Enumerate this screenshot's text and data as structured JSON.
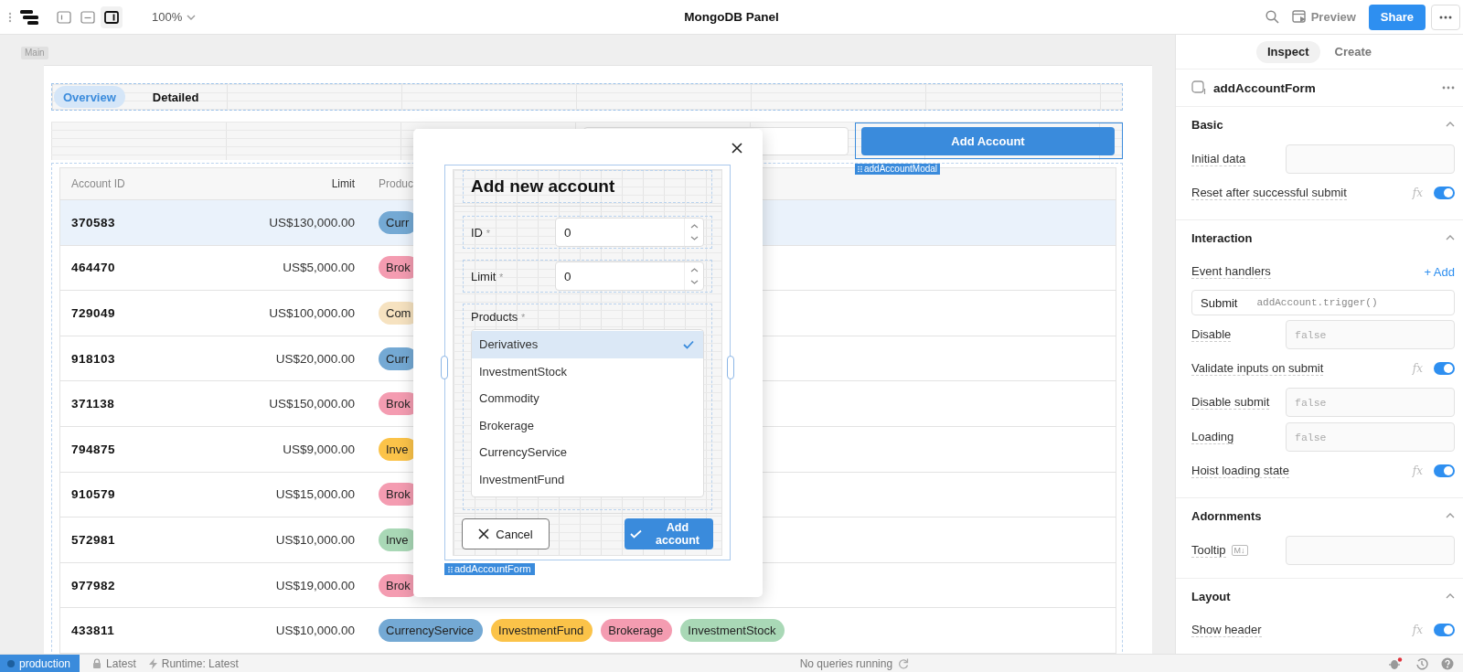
{
  "toolbar": {
    "layout_buttons": [
      {
        "kind": "left",
        "selected": false
      },
      {
        "kind": "bottom",
        "selected": false
      },
      {
        "kind": "right",
        "selected": true
      }
    ],
    "zoom": "100%",
    "title": "MongoDB Panel",
    "preview": "Preview",
    "share": "Share"
  },
  "canvas": {
    "frame_label": "Main",
    "tabs": [
      {
        "label": "Overview",
        "selected": true
      },
      {
        "label": "Detailed",
        "selected": false
      }
    ],
    "add_button": "Add Account",
    "selection_tag": "addAccountModal",
    "table": {
      "columns": [
        "Account ID",
        "Limit",
        "Produc"
      ],
      "rows": [
        {
          "id": "370583",
          "limit": "US$130,000.00",
          "selected": true,
          "products": [
            {
              "label": "Curr",
              "color": "#74a9d4"
            }
          ]
        },
        {
          "id": "464470",
          "limit": "US$5,000.00",
          "selected": false,
          "products": [
            {
              "label": "Brok",
              "color": "#f49cb1"
            }
          ]
        },
        {
          "id": "729049",
          "limit": "US$100,000.00",
          "selected": false,
          "products": [
            {
              "label": "Com",
              "color": "#f6e2c0"
            }
          ]
        },
        {
          "id": "918103",
          "limit": "US$20,000.00",
          "selected": false,
          "products": [
            {
              "label": "Curr",
              "color": "#74a9d4"
            }
          ]
        },
        {
          "id": "371138",
          "limit": "US$150,000.00",
          "selected": false,
          "products": [
            {
              "label": "Brok",
              "color": "#f49cb1"
            }
          ]
        },
        {
          "id": "794875",
          "limit": "US$9,000.00",
          "selected": false,
          "products": [
            {
              "label": "Inve",
              "color": "#fbc349"
            }
          ]
        },
        {
          "id": "910579",
          "limit": "US$15,000.00",
          "selected": false,
          "products": [
            {
              "label": "Brok",
              "color": "#f49cb1"
            }
          ]
        },
        {
          "id": "572981",
          "limit": "US$10,000.00",
          "selected": false,
          "products": [
            {
              "label": "Inve",
              "color": "#a9d8b6"
            }
          ]
        },
        {
          "id": "977982",
          "limit": "US$19,000.00",
          "selected": false,
          "products": [
            {
              "label": "Brok",
              "color": "#f49cb1"
            }
          ]
        },
        {
          "id": "433811",
          "limit": "US$10,000.00",
          "selected": false,
          "products": [
            {
              "label": "CurrencyService",
              "color": "#74a9d4"
            },
            {
              "label": "InvestmentFund",
              "color": "#fbc349"
            },
            {
              "label": "Brokerage",
              "color": "#f49cb1"
            },
            {
              "label": "InvestmentStock",
              "color": "#a9d8b6"
            }
          ]
        }
      ]
    }
  },
  "modal": {
    "title": "Add new account",
    "fields": [
      {
        "label": "ID",
        "mark": "*",
        "value": "0"
      },
      {
        "label": "Limit",
        "mark": "*",
        "value": "0"
      }
    ],
    "products_label": "Products",
    "products_mark": "*",
    "options": [
      {
        "label": "Derivatives",
        "selected": true
      },
      {
        "label": "InvestmentStock",
        "selected": false
      },
      {
        "label": "Commodity",
        "selected": false
      },
      {
        "label": "Brokerage",
        "selected": false
      },
      {
        "label": "CurrencyService",
        "selected": false
      },
      {
        "label": "InvestmentFund",
        "selected": false
      }
    ],
    "cancel": "Cancel",
    "submit": "Add account",
    "form_tag": "addAccountForm"
  },
  "inspector": {
    "tabs": [
      {
        "label": "Inspect",
        "selected": true
      },
      {
        "label": "Create",
        "selected": false
      }
    ],
    "component": "addAccountForm",
    "sections": [
      {
        "title": "Basic",
        "expanded": true,
        "rows": [
          {
            "kind": "input",
            "label": "Initial data"
          },
          {
            "kind": "toggle",
            "label": "Reset after successful submit",
            "formula": "fx",
            "on": true
          }
        ]
      },
      {
        "title": "Interaction",
        "expanded": true,
        "rows": [
          {
            "kind": "link",
            "label": "Event handlers",
            "action": "+ Add"
          },
          {
            "kind": "handler",
            "event": "Submit",
            "action": "addAccount.trigger()"
          },
          {
            "kind": "input",
            "label": "Disable",
            "placeholder": "false"
          },
          {
            "kind": "toggle",
            "label": "Validate inputs on submit",
            "formula": "fx",
            "on": true
          },
          {
            "kind": "input",
            "label": "Disable submit",
            "placeholder": "false"
          },
          {
            "kind": "input",
            "label": "Loading",
            "placeholder": "false"
          },
          {
            "kind": "toggle",
            "label": "Hoist loading state",
            "formula": "fx",
            "on": true
          }
        ]
      },
      {
        "title": "Adornments",
        "expanded": true,
        "rows": [
          {
            "kind": "input",
            "label": "Tooltip",
            "badge": "M↓"
          }
        ]
      },
      {
        "title": "Layout",
        "expanded": true,
        "rows": [
          {
            "kind": "toggle",
            "label": "Show header",
            "formula": "fx",
            "on": true
          }
        ]
      }
    ]
  },
  "status_bar": {
    "environment": "production",
    "release": "Latest",
    "runtime": "Runtime: Latest",
    "queries": "No queries running"
  }
}
